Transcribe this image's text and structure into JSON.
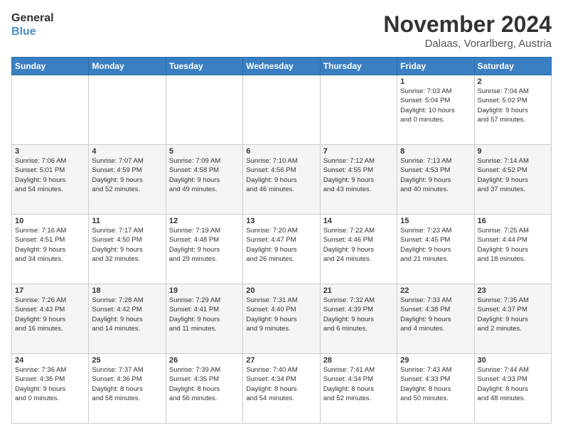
{
  "logo": {
    "line1": "General",
    "line2": "Blue"
  },
  "title": "November 2024",
  "location": "Dalaas, Vorarlberg, Austria",
  "weekdays": [
    "Sunday",
    "Monday",
    "Tuesday",
    "Wednesday",
    "Thursday",
    "Friday",
    "Saturday"
  ],
  "weeks": [
    [
      {
        "day": "",
        "detail": ""
      },
      {
        "day": "",
        "detail": ""
      },
      {
        "day": "",
        "detail": ""
      },
      {
        "day": "",
        "detail": ""
      },
      {
        "day": "",
        "detail": ""
      },
      {
        "day": "1",
        "detail": "Sunrise: 7:03 AM\nSunset: 5:04 PM\nDaylight: 10 hours\nand 0 minutes."
      },
      {
        "day": "2",
        "detail": "Sunrise: 7:04 AM\nSunset: 5:02 PM\nDaylight: 9 hours\nand 57 minutes."
      }
    ],
    [
      {
        "day": "3",
        "detail": "Sunrise: 7:06 AM\nSunset: 5:01 PM\nDaylight: 9 hours\nand 54 minutes."
      },
      {
        "day": "4",
        "detail": "Sunrise: 7:07 AM\nSunset: 4:59 PM\nDaylight: 9 hours\nand 52 minutes."
      },
      {
        "day": "5",
        "detail": "Sunrise: 7:09 AM\nSunset: 4:58 PM\nDaylight: 9 hours\nand 49 minutes."
      },
      {
        "day": "6",
        "detail": "Sunrise: 7:10 AM\nSunset: 4:56 PM\nDaylight: 9 hours\nand 46 minutes."
      },
      {
        "day": "7",
        "detail": "Sunrise: 7:12 AM\nSunset: 4:55 PM\nDaylight: 9 hours\nand 43 minutes."
      },
      {
        "day": "8",
        "detail": "Sunrise: 7:13 AM\nSunset: 4:53 PM\nDaylight: 9 hours\nand 40 minutes."
      },
      {
        "day": "9",
        "detail": "Sunrise: 7:14 AM\nSunset: 4:52 PM\nDaylight: 9 hours\nand 37 minutes."
      }
    ],
    [
      {
        "day": "10",
        "detail": "Sunrise: 7:16 AM\nSunset: 4:51 PM\nDaylight: 9 hours\nand 34 minutes."
      },
      {
        "day": "11",
        "detail": "Sunrise: 7:17 AM\nSunset: 4:50 PM\nDaylight: 9 hours\nand 32 minutes."
      },
      {
        "day": "12",
        "detail": "Sunrise: 7:19 AM\nSunset: 4:48 PM\nDaylight: 9 hours\nand 29 minutes."
      },
      {
        "day": "13",
        "detail": "Sunrise: 7:20 AM\nSunset: 4:47 PM\nDaylight: 9 hours\nand 26 minutes."
      },
      {
        "day": "14",
        "detail": "Sunrise: 7:22 AM\nSunset: 4:46 PM\nDaylight: 9 hours\nand 24 minutes."
      },
      {
        "day": "15",
        "detail": "Sunrise: 7:23 AM\nSunset: 4:45 PM\nDaylight: 9 hours\nand 21 minutes."
      },
      {
        "day": "16",
        "detail": "Sunrise: 7:25 AM\nSunset: 4:44 PM\nDaylight: 9 hours\nand 18 minutes."
      }
    ],
    [
      {
        "day": "17",
        "detail": "Sunrise: 7:26 AM\nSunset: 4:43 PM\nDaylight: 9 hours\nand 16 minutes."
      },
      {
        "day": "18",
        "detail": "Sunrise: 7:28 AM\nSunset: 4:42 PM\nDaylight: 9 hours\nand 14 minutes."
      },
      {
        "day": "19",
        "detail": "Sunrise: 7:29 AM\nSunset: 4:41 PM\nDaylight: 9 hours\nand 11 minutes."
      },
      {
        "day": "20",
        "detail": "Sunrise: 7:31 AM\nSunset: 4:40 PM\nDaylight: 9 hours\nand 9 minutes."
      },
      {
        "day": "21",
        "detail": "Sunrise: 7:32 AM\nSunset: 4:39 PM\nDaylight: 9 hours\nand 6 minutes."
      },
      {
        "day": "22",
        "detail": "Sunrise: 7:33 AM\nSunset: 4:38 PM\nDaylight: 9 hours\nand 4 minutes."
      },
      {
        "day": "23",
        "detail": "Sunrise: 7:35 AM\nSunset: 4:37 PM\nDaylight: 9 hours\nand 2 minutes."
      }
    ],
    [
      {
        "day": "24",
        "detail": "Sunrise: 7:36 AM\nSunset: 4:36 PM\nDaylight: 9 hours\nand 0 minutes."
      },
      {
        "day": "25",
        "detail": "Sunrise: 7:37 AM\nSunset: 4:36 PM\nDaylight: 8 hours\nand 58 minutes."
      },
      {
        "day": "26",
        "detail": "Sunrise: 7:39 AM\nSunset: 4:35 PM\nDaylight: 8 hours\nand 56 minutes."
      },
      {
        "day": "27",
        "detail": "Sunrise: 7:40 AM\nSunset: 4:34 PM\nDaylight: 8 hours\nand 54 minutes."
      },
      {
        "day": "28",
        "detail": "Sunrise: 7:41 AM\nSunset: 4:34 PM\nDaylight: 8 hours\nand 52 minutes."
      },
      {
        "day": "29",
        "detail": "Sunrise: 7:43 AM\nSunset: 4:33 PM\nDaylight: 8 hours\nand 50 minutes."
      },
      {
        "day": "30",
        "detail": "Sunrise: 7:44 AM\nSunset: 4:33 PM\nDaylight: 8 hours\nand 48 minutes."
      }
    ]
  ]
}
